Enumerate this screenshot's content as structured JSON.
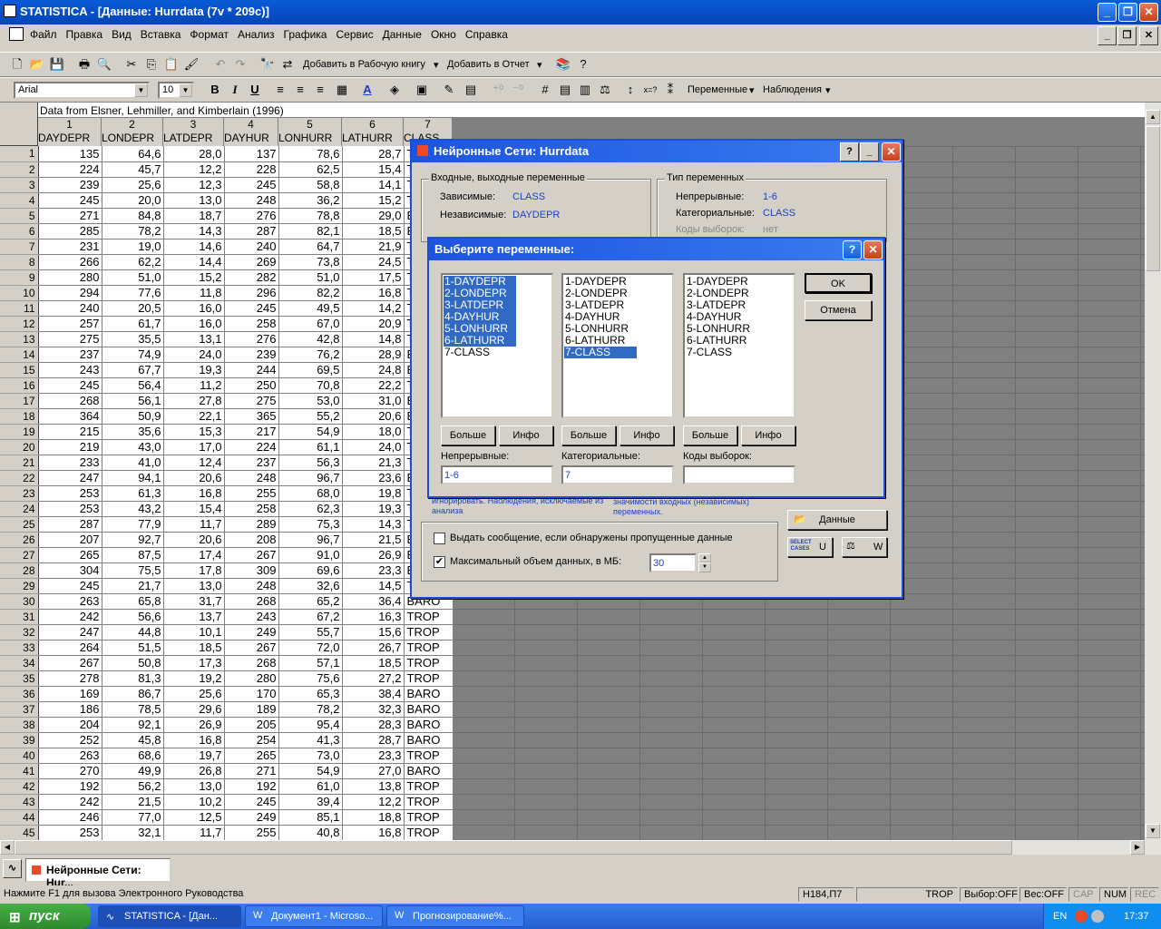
{
  "app": {
    "title": "STATISTICA - [Данные: Hurrdata (7v * 209c)]"
  },
  "menu": [
    "Файл",
    "Правка",
    "Вид",
    "Вставка",
    "Формат",
    "Анализ",
    "Графика",
    "Сервис",
    "Данные",
    "Окно",
    "Справка"
  ],
  "toolbar1": {
    "add_workbook": "Добавить в Рабочую книгу",
    "add_report": "Добавить в Отчет"
  },
  "toolbar2": {
    "font": "Arial",
    "size": "10",
    "variables": "Переменные",
    "cases": "Наблюдения"
  },
  "sheet": {
    "caption": "Data from Elsner, Lehmiller, and Kimberlain (1996)",
    "col_nums": [
      "1",
      "2",
      "3",
      "4",
      "5",
      "6",
      "7"
    ],
    "col_names": [
      "DAYDEPR",
      "LONDEPR",
      "LATDEPR",
      "DAYHUR",
      "LONHURR",
      "LATHURR",
      "CLASS"
    ],
    "rows": [
      [
        "1",
        "135",
        "64,6",
        "28,0",
        "137",
        "78,6",
        "28,7",
        "TROP"
      ],
      [
        "2",
        "224",
        "45,7",
        "12,2",
        "228",
        "62,5",
        "15,4",
        "TROP"
      ],
      [
        "3",
        "239",
        "25,6",
        "12,3",
        "245",
        "58,8",
        "14,1",
        "TROP"
      ],
      [
        "4",
        "245",
        "20,0",
        "13,0",
        "248",
        "36,2",
        "15,2",
        "TROP"
      ],
      [
        "5",
        "271",
        "84,8",
        "18,7",
        "276",
        "78,8",
        "29,0",
        "BARO"
      ],
      [
        "6",
        "285",
        "78,2",
        "14,3",
        "287",
        "82,1",
        "18,5",
        "BARO"
      ],
      [
        "7",
        "231",
        "19,0",
        "14,6",
        "240",
        "64,7",
        "21,9",
        "TROP"
      ],
      [
        "8",
        "266",
        "62,2",
        "14,4",
        "269",
        "73,8",
        "24,5",
        "TROP"
      ],
      [
        "9",
        "280",
        "51,0",
        "15,2",
        "282",
        "51,0",
        "17,5",
        "TROP"
      ],
      [
        "10",
        "294",
        "77,6",
        "11,8",
        "296",
        "82,2",
        "16,8",
        "TROP"
      ],
      [
        "11",
        "240",
        "20,5",
        "16,0",
        "245",
        "49,5",
        "14,2",
        "TROP"
      ],
      [
        "12",
        "257",
        "61,7",
        "16,0",
        "258",
        "67,0",
        "20,9",
        "TROP"
      ],
      [
        "13",
        "275",
        "35,5",
        "13,1",
        "276",
        "42,8",
        "14,8",
        "TROP"
      ],
      [
        "14",
        "237",
        "74,9",
        "24,0",
        "239",
        "76,2",
        "28,9",
        "BARO"
      ],
      [
        "15",
        "243",
        "67,7",
        "19,3",
        "244",
        "69,5",
        "24,8",
        "BARO"
      ],
      [
        "16",
        "245",
        "56,4",
        "11,2",
        "250",
        "70,8",
        "22,2",
        "TROP"
      ],
      [
        "17",
        "268",
        "56,1",
        "27,8",
        "275",
        "53,0",
        "31,0",
        "BARO"
      ],
      [
        "18",
        "364",
        "50,9",
        "22,1",
        "365",
        "55,2",
        "20,6",
        "BARO"
      ],
      [
        "19",
        "215",
        "35,6",
        "15,3",
        "217",
        "54,9",
        "18,0",
        "TROP"
      ],
      [
        "20",
        "219",
        "43,0",
        "17,0",
        "224",
        "61,1",
        "24,0",
        "TROP"
      ],
      [
        "21",
        "233",
        "41,0",
        "12,4",
        "237",
        "56,3",
        "21,3",
        "TROP"
      ],
      [
        "22",
        "247",
        "94,1",
        "20,6",
        "248",
        "96,7",
        "23,6",
        "BARO"
      ],
      [
        "23",
        "253",
        "61,3",
        "16,8",
        "255",
        "68,0",
        "19,8",
        "TROP"
      ],
      [
        "24",
        "253",
        "43,2",
        "15,4",
        "258",
        "62,3",
        "19,3",
        "TROP"
      ],
      [
        "25",
        "287",
        "77,9",
        "11,7",
        "289",
        "75,3",
        "14,3",
        "TROP"
      ],
      [
        "26",
        "207",
        "92,7",
        "20,6",
        "208",
        "96,7",
        "21,5",
        "BARO"
      ],
      [
        "27",
        "265",
        "87,5",
        "17,4",
        "267",
        "91,0",
        "26,9",
        "BARO"
      ],
      [
        "28",
        "304",
        "75,5",
        "17,8",
        "309",
        "69,6",
        "23,3",
        "BARO"
      ],
      [
        "29",
        "245",
        "21,7",
        "13,0",
        "248",
        "32,6",
        "14,5",
        "TROP"
      ],
      [
        "30",
        "263",
        "65,8",
        "31,7",
        "268",
        "65,2",
        "36,4",
        "BARO"
      ],
      [
        "31",
        "242",
        "56,6",
        "13,7",
        "243",
        "67,2",
        "16,3",
        "TROP"
      ],
      [
        "32",
        "247",
        "44,8",
        "10,1",
        "249",
        "55,7",
        "15,6",
        "TROP"
      ],
      [
        "33",
        "264",
        "51,5",
        "18,5",
        "267",
        "72,0",
        "26,7",
        "TROP"
      ],
      [
        "34",
        "267",
        "50,8",
        "17,3",
        "268",
        "57,1",
        "18,5",
        "TROP"
      ],
      [
        "35",
        "278",
        "81,3",
        "19,2",
        "280",
        "75,6",
        "27,2",
        "TROP"
      ],
      [
        "36",
        "169",
        "86,7",
        "25,6",
        "170",
        "65,3",
        "38,4",
        "BARO"
      ],
      [
        "37",
        "186",
        "78,5",
        "29,6",
        "189",
        "78,2",
        "32,3",
        "BARO"
      ],
      [
        "38",
        "204",
        "92,1",
        "26,9",
        "205",
        "95,4",
        "28,3",
        "BARO"
      ],
      [
        "39",
        "252",
        "45,8",
        "16,8",
        "254",
        "41,3",
        "28,7",
        "BARO"
      ],
      [
        "40",
        "263",
        "68,6",
        "19,7",
        "265",
        "73,0",
        "23,3",
        "TROP"
      ],
      [
        "41",
        "270",
        "49,9",
        "26,8",
        "271",
        "54,9",
        "27,0",
        "BARO"
      ],
      [
        "42",
        "192",
        "56,2",
        "13,0",
        "192",
        "61,0",
        "13,8",
        "TROP"
      ],
      [
        "43",
        "242",
        "21,5",
        "10,2",
        "245",
        "39,4",
        "12,2",
        "TROP"
      ],
      [
        "44",
        "246",
        "77,0",
        "12,5",
        "249",
        "85,1",
        "18,8",
        "TROP"
      ],
      [
        "45",
        "253",
        "32,1",
        "11,7",
        "255",
        "40,8",
        "16,8",
        "TROP"
      ]
    ]
  },
  "nn_dialog": {
    "title": "Нейронные Сети: Hurrdata",
    "io_group": "Входные, выходные переменные",
    "dep_label": "Зависимые:",
    "dep_value": "CLASS",
    "indep_label": "Независимые:",
    "indep_value": "DAYDEPR",
    "type_group": "Тип переменных",
    "cont_label": "Непрерывные:",
    "cont_value": "1-6",
    "cat_label": "Категориальные:",
    "cat_value": "CLASS",
    "codes_label": "Коды выборок:",
    "codes_value": "нет",
    "hint1": "игнорировать. Наблюдения, исключаемые из анализа",
    "hint2": "значимости входных (независимых) переменных.",
    "data_button": "Данные",
    "select_cases": "SELECT CASES",
    "u_button": "U",
    "w_button": "W",
    "msg_checkbox": "Выдать сообщение, если обнаружены пропущенные данные",
    "max_checkbox": "Максимальный объем данных, в МБ:",
    "max_value": "30"
  },
  "var_dialog": {
    "title": "Выберите переменные:",
    "variables": [
      "1-DAYDEPR",
      "2-LONDEPR",
      "3-LATDEPR",
      "4-DAYHUR",
      "5-LONHURR",
      "6-LATHURR",
      "7-CLASS"
    ],
    "more": "Больше",
    "info": "Инфо",
    "cont_label": "Непрерывные:",
    "cont_value": "1-6",
    "cat_label": "Категориальные:",
    "cat_value": "7",
    "codes_label": "Коды выборок:",
    "codes_value": "",
    "ok": "OK",
    "cancel": "Отмена"
  },
  "docbar": {
    "tab": "Нейронные Сети: Hur..."
  },
  "status": {
    "help": "Нажмите F1 для вызова Электронного Руководства",
    "cell": "H184,П7",
    "value": "TROP",
    "sel": "Выбор:OFF",
    "weight": "Вес:OFF",
    "cap": "CAP",
    "num": "NUM",
    "rec": "REC"
  },
  "taskbar": {
    "start": "пуск",
    "tasks": [
      "STATISTICA - [Дан...",
      "Документ1 - Microso...",
      "Прогнозирование%..."
    ],
    "lang": "EN",
    "time": "17:37"
  }
}
